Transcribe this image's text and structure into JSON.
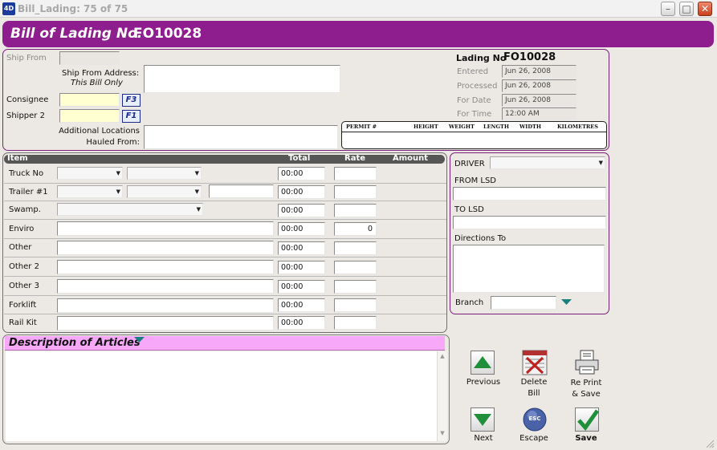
{
  "window": {
    "title": "Bill_Lading: 75 of 75",
    "app_icon_text": "4D"
  },
  "header": {
    "label": "Bill of Lading No.",
    "number": "FO10028"
  },
  "shipping": {
    "ship_from_label": "Ship From",
    "ship_from_address_label": "Ship From Address:",
    "this_bill_only": "This Bill Only",
    "consignee_label": "Consignee",
    "consignee_key": "F3",
    "shipper2_label": "Shipper 2",
    "shipper2_key": "F1",
    "additional_locations_label_1": "Additional Locations",
    "additional_locations_label_2": "Hauled From:"
  },
  "lading": {
    "label": "Lading No",
    "number": "FO10028",
    "entered_label": "Entered",
    "entered": "Jun 26, 2008",
    "processed_label": "Processed",
    "processed": "Jun 26, 2008",
    "for_date_label": "For Date",
    "for_date": "Jun 26, 2008",
    "for_time_label": "For Time",
    "for_time": "12:00 AM"
  },
  "permit": {
    "columns": [
      "PERMIT #",
      "HEIGHT",
      "WEIGHT",
      "LENGTH",
      "WIDTH",
      "KILOMETRES"
    ]
  },
  "items": {
    "headers": {
      "item": "Item",
      "total": "Total",
      "rate": "Rate",
      "amount": "Amount"
    },
    "rows": [
      {
        "label": "Truck No",
        "total": "00:00",
        "rate": ""
      },
      {
        "label": "Trailer #1",
        "total": "00:00",
        "rate": ""
      },
      {
        "label": "Swamp.",
        "total": "00:00",
        "rate": ""
      },
      {
        "label": "Enviro",
        "total": "00:00",
        "rate": "0"
      },
      {
        "label": "Other",
        "total": "00:00",
        "rate": ""
      },
      {
        "label": "Other 2",
        "total": "00:00",
        "rate": ""
      },
      {
        "label": "Other 3",
        "total": "00:00",
        "rate": ""
      },
      {
        "label": "Forklift",
        "total": "00:00",
        "rate": ""
      },
      {
        "label": "Rail Kit",
        "total": "00:00",
        "rate": ""
      }
    ]
  },
  "driver": {
    "driver_label": "DRIVER",
    "from_lsd_label": "FROM LSD",
    "to_lsd_label": "TO LSD",
    "directions_label": "Directions To",
    "branch_label": "Branch"
  },
  "description": {
    "title": "Description of Articles"
  },
  "actions": {
    "previous": "Previous",
    "delete_1": "Delete",
    "delete_2": "Bill",
    "reprint_1": "Re Print",
    "reprint_2": "& Save",
    "next": "Next",
    "escape": "Escape",
    "escape_icon_text": "ESC",
    "save": "Save"
  },
  "colors": {
    "banner": "#8E1D8E",
    "panel_border": "#7C1E7C",
    "description_header": "#F8A8F8",
    "arrow_green": "#1F8F3A",
    "dropdown_teal": "#1A7F7F"
  }
}
